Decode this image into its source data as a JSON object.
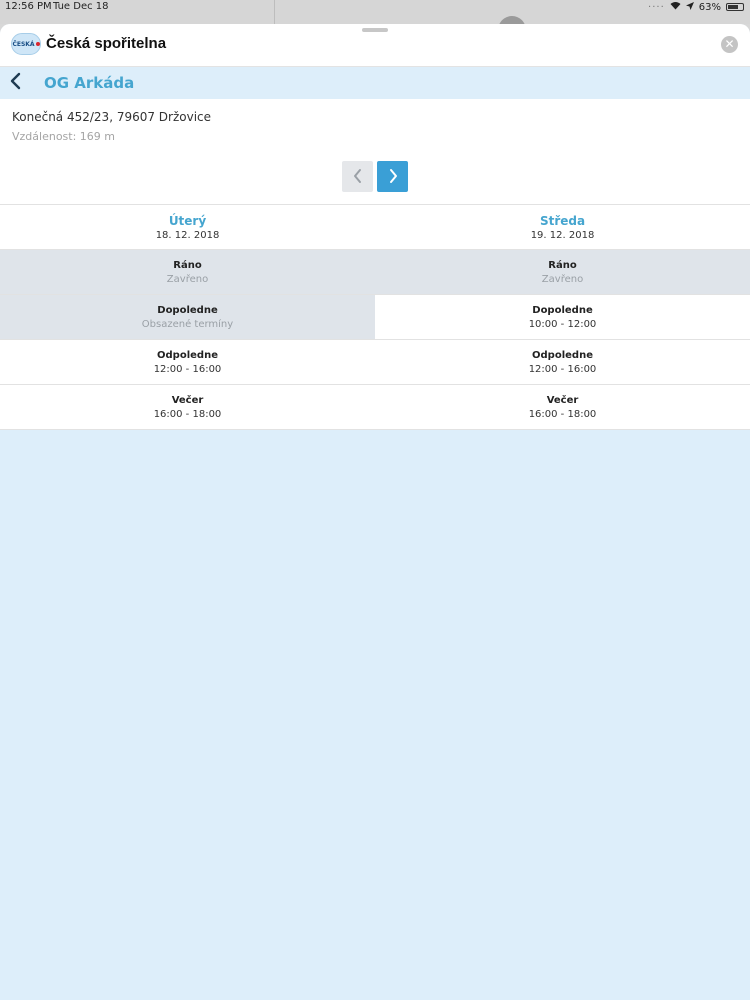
{
  "status_bar": {
    "time": "12:56 PM",
    "date": "Tue Dec 18",
    "battery": "63%"
  },
  "app": {
    "logo_text": "ČESKÁ",
    "title": "Česká spořitelna",
    "close_icon": "close-icon"
  },
  "nav": {
    "title": "OG Arkáda",
    "back_icon": "chevron-left-icon"
  },
  "branch": {
    "address": "Konečná 452/23, 79607 Držovice",
    "distance": "Vzdálenost: 169 m"
  },
  "pager": {
    "prev_icon": "chevron-left-icon",
    "next_icon": "chevron-right-icon"
  },
  "days": [
    {
      "name": "Úterý",
      "date": "18. 12. 2018",
      "slots": [
        {
          "name": "Ráno",
          "value": "Zavřeno",
          "available": false
        },
        {
          "name": "Dopoledne",
          "value": "Obsazené termíny",
          "available": false
        },
        {
          "name": "Odpoledne",
          "value": "12:00 - 16:00",
          "available": true
        },
        {
          "name": "Večer",
          "value": "16:00 - 18:00",
          "available": true
        }
      ]
    },
    {
      "name": "Středa",
      "date": "19. 12. 2018",
      "slots": [
        {
          "name": "Ráno",
          "value": "Zavřeno",
          "available": false
        },
        {
          "name": "Dopoledne",
          "value": "10:00 - 12:00",
          "available": true
        },
        {
          "name": "Odpoledne",
          "value": "12:00 - 16:00",
          "available": true
        },
        {
          "name": "Večer",
          "value": "16:00 - 18:00",
          "available": true
        }
      ]
    }
  ],
  "colors": {
    "accent": "#45a5cf",
    "button_active": "#3a9fd6",
    "unavailable_bg": "#dfe4ea",
    "sheet_bg": "#ddeefa"
  }
}
